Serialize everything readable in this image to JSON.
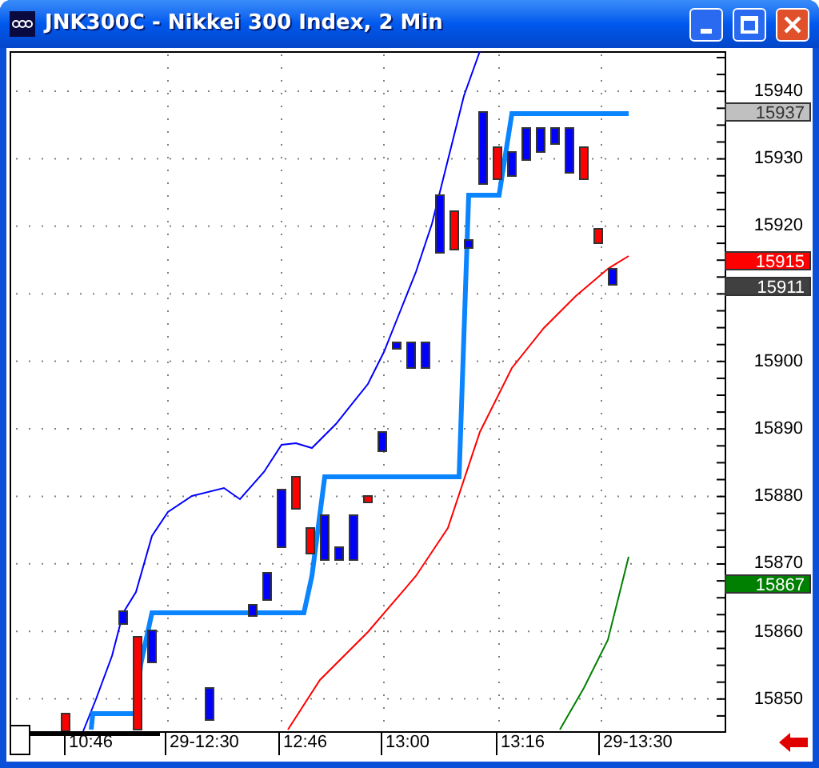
{
  "window": {
    "title": "JNK300C - Nikkei 300 Index, 2 Min"
  },
  "y_axis": {
    "ticks": [
      "15940",
      "15930",
      "15920",
      "15900",
      "15890",
      "15880",
      "15870",
      "15860",
      "15850"
    ]
  },
  "price_tags": [
    {
      "label": "15937",
      "color": "#c0c0c0"
    },
    {
      "label": "15915",
      "color": "#ff0000"
    },
    {
      "label": "15911",
      "color": "#404040"
    },
    {
      "label": "15867",
      "color": "#008000"
    }
  ],
  "x_axis": {
    "labels": [
      "10:46",
      "29-12:30",
      "12:46",
      "13:00",
      "13:16",
      "29-13:30"
    ]
  }
}
